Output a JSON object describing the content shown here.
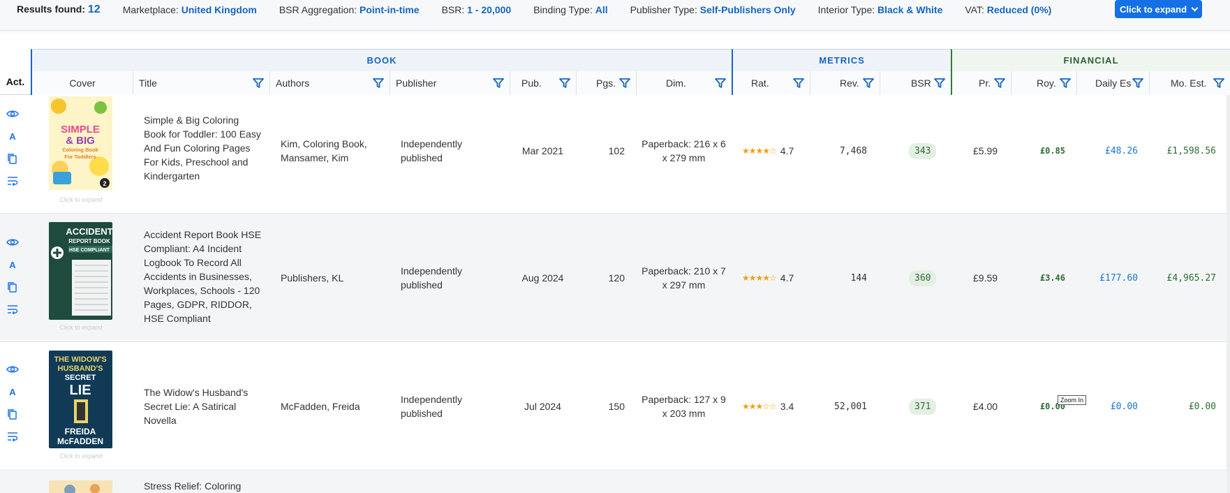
{
  "filters": {
    "results_label": "Results found:",
    "results_value": "12",
    "marketplace_label": "Marketplace:",
    "marketplace_value": "United Kingdom",
    "bsr_agg_label": "BSR Aggregation:",
    "bsr_agg_value": "Point-in-time",
    "bsr_label": "BSR:",
    "bsr_value": "1 - 20,000",
    "binding_label": "Binding Type:",
    "binding_value": "All",
    "publisher_label": "Publisher Type:",
    "publisher_value": "Self-Publishers Only",
    "interior_label": "Interior Type:",
    "interior_value": "Black & White",
    "vat_label": "VAT:",
    "vat_value": "Reduced (0%)",
    "expand_label": "Click to expand"
  },
  "groups": {
    "book": "BOOK",
    "metrics": "METRICS",
    "financial": "FINANCIAL"
  },
  "columns": {
    "act": "Act.",
    "cover": "Cover",
    "title": "Title",
    "authors": "Authors",
    "publisher": "Publisher",
    "pub": "Pub.",
    "pgs": "Pgs.",
    "dim": "Dim.",
    "rat": "Rat.",
    "rev": "Rev.",
    "bsr": "BSR",
    "pr": "Pr.",
    "roy": "Roy.",
    "daily": "Daily Es",
    "mo": "Mo. Est."
  },
  "cover_caption": "Click to expand",
  "tooltip": "Zoom In",
  "rows": [
    {
      "title": "Simple & Big Coloring Book for Toddler: 100 Easy And Fun Coloring Pages For Kids, Preschool and Kindergarten",
      "authors": "Kim, Coloring Book, Mansamer, Kim",
      "publisher": "Independently published",
      "pub": "Mar 2021",
      "pgs": "102",
      "dim": "Paperback: 216 x 6 x 279 mm",
      "stars": "★★★★☆",
      "rating": "4.7",
      "reviews": "7,468",
      "bsr": "343",
      "price": "£5.99",
      "royalty": "£0.85",
      "daily": "£48.26",
      "monthly": "£1,598.56",
      "cover_text": [
        "SIMPLE",
        "& BIG",
        "Coloring Book",
        "For Toddlers",
        "2"
      ]
    },
    {
      "title": "Accident Report Book HSE Compliant: A4 Incident Logbook To Record All Accidents in Businesses, Workplaces, Schools - 120 Pages, GDPR, RIDDOR, HSE Compliant",
      "authors": "Publishers, KL",
      "publisher": "Independently published",
      "pub": "Aug 2024",
      "pgs": "120",
      "dim": "Paperback: 210 x 7 x 297 mm",
      "stars": "★★★★☆",
      "rating": "4.7",
      "reviews": "144",
      "bsr": "360",
      "price": "£9.59",
      "royalty": "£3.46",
      "daily": "£177.60",
      "monthly": "£4,965.27",
      "cover_text": [
        "ACCIDENT",
        "REPORT BOOK",
        "HSE COMPLIANT"
      ]
    },
    {
      "title": "The Widow's Husband's Secret Lie: A Satirical Novella",
      "authors": "McFadden, Freida",
      "publisher": "Independently published",
      "pub": "Jul 2024",
      "pgs": "150",
      "dim": "Paperback: 127 x 9 x 203 mm",
      "stars": "★★★☆☆",
      "rating": "3.4",
      "reviews": "52,001",
      "bsr": "371",
      "price": "£4.00",
      "royalty": "£0.00",
      "daily": "£0.00",
      "monthly": "£0.00",
      "cover_text": [
        "THE WIDOW'S",
        "HUSBAND'S",
        "SECRET",
        "LIE",
        "FREIDA",
        "McFADDEN"
      ]
    },
    {
      "title": "Stress Relief: Coloring"
    }
  ],
  "colors": {
    "accent_blue": "#1565c0",
    "button_blue": "#1570e6",
    "financial_green": "#2e7d32",
    "star_orange": "#f39c12"
  }
}
